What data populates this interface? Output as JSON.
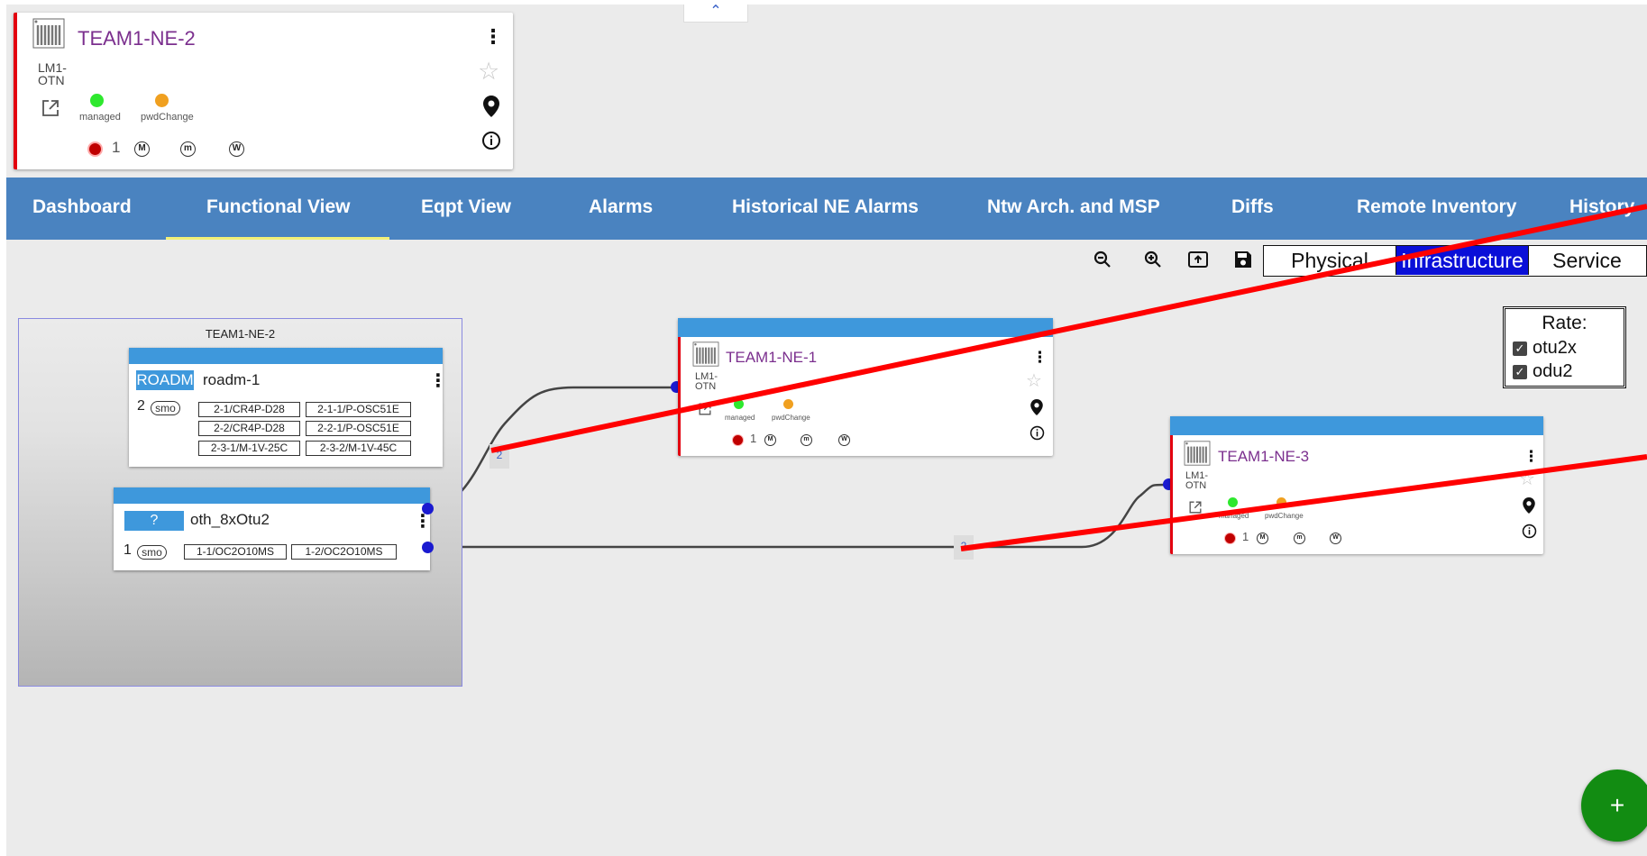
{
  "top_card": {
    "ne_name": "TEAM1-NE-2",
    "ne_type_line1": "LM1-",
    "ne_type_line2": "OTN",
    "status_1": "managed",
    "status_2": "pwdChange",
    "alarm_count": "1",
    "severity_major": "M",
    "severity_minor": "m",
    "severity_warning": "W"
  },
  "collapse_glyph": "⌃",
  "nav": {
    "tabs": [
      {
        "label": "Dashboard"
      },
      {
        "label": "Functional View"
      },
      {
        "label": "Eqpt View"
      },
      {
        "label": "Alarms"
      },
      {
        "label": "Historical NE Alarms"
      },
      {
        "label": "Ntw Arch. and MSP"
      },
      {
        "label": "Diffs"
      },
      {
        "label": "Remote Inventory"
      },
      {
        "label": "History"
      }
    ],
    "active_tab": "Functional View"
  },
  "toolbar": {
    "icons": [
      "zoom-out-icon",
      "zoom-in-icon",
      "export-icon",
      "save-icon"
    ],
    "views": {
      "physical": "Physical",
      "infrastructure": "Infrastructure",
      "service": "Service"
    },
    "active_view": "Infrastructure"
  },
  "rate_filter": {
    "title": "Rate:",
    "items": [
      {
        "label": "otu2x",
        "checked": true
      },
      {
        "label": "odu2",
        "checked": true
      }
    ]
  },
  "group": {
    "title": "TEAM1-NE-2",
    "roadm": {
      "tag": "ROADM",
      "name": "roadm-1",
      "count": "2",
      "smo": "smo",
      "ports": [
        "2-1/CR4P-D28",
        "2-1-1/P-OSC51E",
        "2-2/CR4P-D28",
        "2-2-1/P-OSC51E",
        "2-3-1/M-1V-25C",
        "2-3-2/M-1V-45C"
      ]
    },
    "oth": {
      "tag": "?",
      "name": "oth_8xOtu2",
      "count": "1",
      "smo": "smo",
      "ports": [
        "1-1/OC2O10MS",
        "1-2/OC2O10MS"
      ]
    }
  },
  "ne1": {
    "name": "TEAM1-NE-1",
    "type_line1": "LM1-",
    "type_line2": "OTN",
    "status_1": "managed",
    "status_2": "pwdChange",
    "alarm_count": "1",
    "severity_major": "M",
    "severity_minor": "m",
    "severity_warning": "W"
  },
  "ne3": {
    "name": "TEAM1-NE-3",
    "type_line1": "LM1-",
    "type_line2": "OTN",
    "status_1": "managed",
    "status_2": "pwdChange",
    "alarm_count": "1",
    "severity_major": "M",
    "severity_minor": "m",
    "severity_warning": "W"
  },
  "links": {
    "upper_label": "2",
    "lower_label": "2"
  },
  "fab_label": "+",
  "colors": {
    "navbar": "#4a83c0",
    "active_tab_underline": "#f2f078",
    "box_header": "#3e98dc",
    "infrastructure_active": "#0a0fd8",
    "alarm_border": "#e3000f",
    "annotation_line": "#ff0000",
    "fab": "#128c12"
  }
}
